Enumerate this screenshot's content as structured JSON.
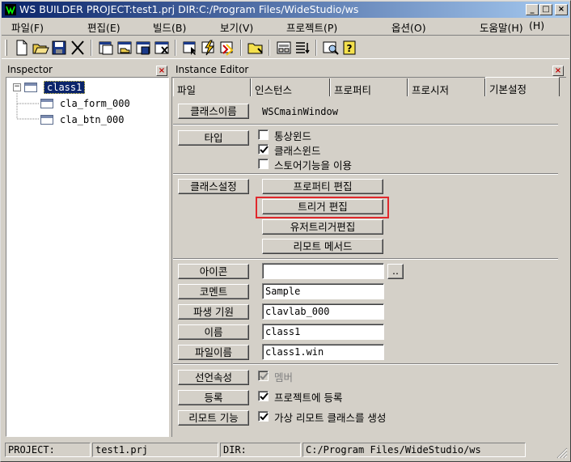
{
  "window": {
    "title": "WS BUILDER PROJECT:test1.prj DIR:C:/Program Files/WideStudio/ws",
    "minimize": "_",
    "maximize": "□",
    "close": "×"
  },
  "menu": [
    "파일(F)",
    "편집(E)",
    "빌드(B)",
    "보기(V)",
    "프로젝트(P)",
    "옵션(O)",
    "도움말(H)",
    "(H)"
  ],
  "toolbar_icons": [
    "new-file-icon",
    "open-folder-icon",
    "save-icon",
    "cut-icon",
    "class-list-icon",
    "open-class-icon",
    "save-class-icon",
    "close-class-icon",
    "select-icon",
    "build-icon",
    "compile-icon",
    "folder-icon",
    "dialog-icon",
    "list-icon",
    "inspect-icon",
    "help-icon"
  ],
  "inspector": {
    "title": "Inspector",
    "close": "×",
    "tree": [
      {
        "label": "class1",
        "selected": true,
        "expander": "⊟"
      },
      {
        "label": "cla_form_000"
      },
      {
        "label": "cla_btn_000"
      }
    ]
  },
  "editor": {
    "title": "Instance Editor",
    "close": "×",
    "tabs": [
      "파일",
      "인스턴스",
      "프로퍼티",
      "프로시저",
      "기본설정"
    ],
    "class_name_button": "클래스이름",
    "class_name_value": "WSCmainWindow",
    "type_button": "타입",
    "type_options": [
      {
        "label": "통상윈드",
        "checked": false
      },
      {
        "label": "클래스윈드",
        "checked": true
      },
      {
        "label": "스토어기능을 이용",
        "checked": false
      }
    ],
    "class_settings_button": "클래스설정",
    "settings_buttons": [
      "프로퍼티 편집",
      "트리거 편집",
      "유저트리거편집",
      "리모트 메서드"
    ],
    "fields": [
      {
        "button": "아이콘",
        "value": "",
        "browse": ".."
      },
      {
        "button": "코멘트",
        "value": "Sample"
      },
      {
        "button": "파생 기원",
        "value": "clavlab_000"
      },
      {
        "button": "이름",
        "value": "class1"
      },
      {
        "button": "파일이름",
        "value": "class1.win"
      }
    ],
    "options": [
      {
        "button": "선언속성",
        "label": "멤버",
        "checked": true,
        "disabled": true
      },
      {
        "button": "등록",
        "label": "프로젝트에 등록",
        "checked": true,
        "disabled": false
      },
      {
        "button": "리모트 기능",
        "label": "가상 리모트 클래스를 생성",
        "checked": true,
        "disabled": false
      }
    ]
  },
  "status": {
    "project_label": "PROJECT:",
    "project_value": "test1.prj",
    "dir_label": "DIR:",
    "dir_value": "C:/Program Files/WideStudio/ws"
  },
  "colors": {
    "highlight": "#e0282c",
    "selection": "#0a246a",
    "titlebar": "#0a246a"
  }
}
